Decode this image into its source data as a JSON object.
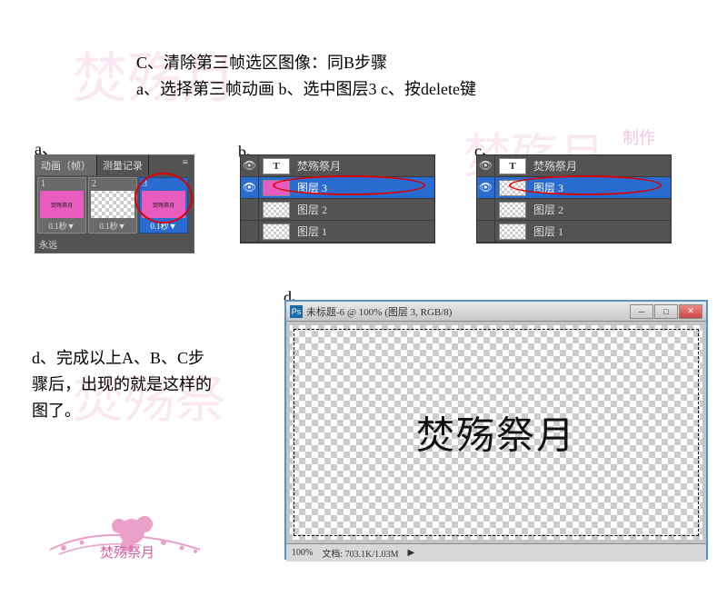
{
  "instructions": {
    "line1": "C、清除第三帧选区图像：同B步骤",
    "line2": "a、选择第三帧动画  b、选中图层3  c、按delete键"
  },
  "labels": {
    "a": "a、",
    "b": "b、",
    "c": "c、",
    "d": "d、"
  },
  "panelA": {
    "tab1": "动画（帧）",
    "tab2": "测量记录",
    "frames": [
      {
        "num": "1",
        "time": "0.1秒▼"
      },
      {
        "num": "2",
        "time": "0.1秒▼"
      },
      {
        "num": "3",
        "time": "0.1秒▼"
      }
    ],
    "loop": "永远"
  },
  "layers": {
    "text_layer": "焚殇祭月",
    "layer3": "图层 3",
    "layer2": "图层 2",
    "layer1": "图层 1",
    "t_label": "T"
  },
  "panelD": {
    "title": "未标题-6 @ 100% (图层 3, RGB/8)",
    "canvas_text": "焚殇祭月",
    "zoom": "100%",
    "docinfo": "文档: 703.1K/1.03M",
    "arrow": "▶"
  },
  "descD": "d、完成以上A、B、C步骤后，出现的就是这样的图了。",
  "watermarks": {
    "wm1": "焚殇月",
    "wm2": "焚殇月",
    "wm3": "焚殇祭",
    "wm4": "制作"
  },
  "icons": {
    "eye": "👁",
    "menu": "≡",
    "tri": "▸"
  }
}
